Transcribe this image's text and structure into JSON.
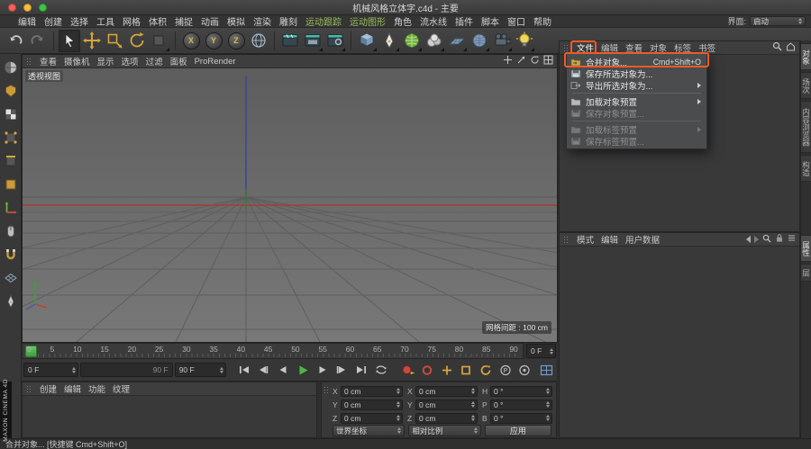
{
  "window": {
    "title": "机械风格立体字.c4d - 主要"
  },
  "menubar": {
    "items": [
      "编辑",
      "创建",
      "选择",
      "工具",
      "网格",
      "体积",
      "捕捉",
      "动画",
      "模拟",
      "渲染",
      "雕刻",
      "运动跟踪",
      "运动图形",
      "角色",
      "流水线",
      "插件",
      "脚本",
      "窗口",
      "帮助"
    ],
    "interface_label": "界面:",
    "interface_value": "启动"
  },
  "toolbar": {
    "icons": [
      "undo-icon",
      "redo-icon",
      "live-selection-icon",
      "move-tool-icon",
      "scale-tool-icon",
      "rotate-tool-icon",
      "tool-history-icon",
      "x-axis-lock-icon",
      "y-axis-lock-icon",
      "z-axis-lock-icon",
      "coordinate-system-icon",
      "render-view-icon",
      "render-picture-viewer-icon",
      "render-settings-icon",
      "primitive-cube-icon",
      "spline-pen-icon",
      "subdivision-surface-icon",
      "volume-builder-icon",
      "floor-object-icon",
      "sky-object-icon",
      "camera-object-icon",
      "light-object-icon"
    ],
    "axis_labels": [
      "X",
      "Y",
      "Z"
    ]
  },
  "left_toolbar": {
    "icons": [
      "make-editable-icon",
      "model-mode-icon",
      "texture-mode-icon",
      "points-mode-icon",
      "edges-mode-icon",
      "polygons-mode-icon",
      "enable-axis-icon",
      "viewport-solo-icon",
      "enable-snap-icon",
      "workplane-icon",
      "paint-tool-icon"
    ]
  },
  "viewport": {
    "menu": [
      "查看",
      "摄像机",
      "显示",
      "选项",
      "过滤",
      "面板",
      "ProRender"
    ],
    "view_icons": [
      "pan-view-icon",
      "zoom-view-icon",
      "rotate-view-icon",
      "toggle-layout-icon"
    ],
    "view_label": "透视视图",
    "grid_spacing": "网格间距 : 100 cm"
  },
  "object_manager": {
    "menu": [
      "文件",
      "编辑",
      "查看",
      "对象",
      "标签",
      "书签"
    ],
    "active_menu": "文件",
    "header_icons": [
      "search-icon",
      "home-icon"
    ],
    "file_menu": {
      "items": [
        {
          "label": "合并对象...",
          "shortcut": "Cmd+Shift+O",
          "enabled": true,
          "highlighted": true
        },
        {
          "label": "保存所选对象为...",
          "enabled": true
        },
        {
          "label": "导出所选对象为...",
          "enabled": true,
          "submenu": true
        },
        {
          "label": "加载对象预置",
          "enabled": true,
          "submenu": true
        },
        {
          "label": "保存对象预置...",
          "enabled": false
        },
        {
          "label": "加载标签预置",
          "enabled": false,
          "submenu": true
        },
        {
          "label": "保存标签预置...",
          "enabled": false
        }
      ]
    }
  },
  "attribute_manager": {
    "menu": [
      "模式",
      "编辑",
      "用户数据"
    ],
    "header_icons": [
      "back-icon",
      "forward-icon",
      "search-icon",
      "lock-icon",
      "menu-icon"
    ]
  },
  "side_tabs": {
    "top": [
      "对象",
      "场次",
      "内容浏览器",
      "构造"
    ],
    "bottom": [
      "属性",
      "层"
    ],
    "active": "对象"
  },
  "timeline": {
    "ticks": [
      "0",
      "5",
      "10",
      "15",
      "20",
      "25",
      "30",
      "35",
      "40",
      "45",
      "50",
      "55",
      "60",
      "65",
      "70",
      "75",
      "80",
      "85",
      "90"
    ],
    "frame_field": "0 F"
  },
  "transport": {
    "start_frame": "0 F",
    "end_frame": "90 F",
    "range_label": "90 F",
    "icons": [
      "goto-start-icon",
      "prev-key-icon",
      "prev-frame-icon",
      "play-icon",
      "next-frame-icon",
      "next-key-icon",
      "goto-end-icon",
      "loop-icon",
      "record-objects-icon",
      "autokey-icon",
      "position-key-icon",
      "scale-key-icon",
      "rotation-key-icon",
      "parameter-key-icon",
      "pla-key-icon",
      "motion-system-icon"
    ]
  },
  "material_manager": {
    "menu": [
      "创建",
      "编辑",
      "功能",
      "纹理"
    ]
  },
  "coordinates": {
    "columns": [
      {
        "rows": [
          {
            "label": "X",
            "value": "0 cm"
          },
          {
            "label": "Y",
            "value": "0 cm"
          },
          {
            "label": "Z",
            "value": "0 cm"
          }
        ]
      },
      {
        "rows": [
          {
            "label": "X",
            "value": "0 cm"
          },
          {
            "label": "Y",
            "value": "0 cm"
          },
          {
            "label": "Z",
            "value": "0 cm"
          }
        ]
      },
      {
        "rows": [
          {
            "label": "H",
            "value": "0 °"
          },
          {
            "label": "P",
            "value": "0 °"
          },
          {
            "label": "B",
            "value": "0 °"
          }
        ]
      }
    ],
    "coord_system": "世界坐标",
    "size_mode": "相对比例",
    "apply": "应用"
  },
  "status_bar": {
    "text": "合并对象... [快捷键 Cmd+Shift+O]"
  },
  "branding": {
    "logo_text": "MAXON CINEMA 4D"
  },
  "accent_colors": {
    "highlight_orange": "#f05a24",
    "mograph_green": "#9bbf5a",
    "play_green": "#4db848",
    "record_red": "#c9493e",
    "key_amber": "#d7a43a"
  }
}
